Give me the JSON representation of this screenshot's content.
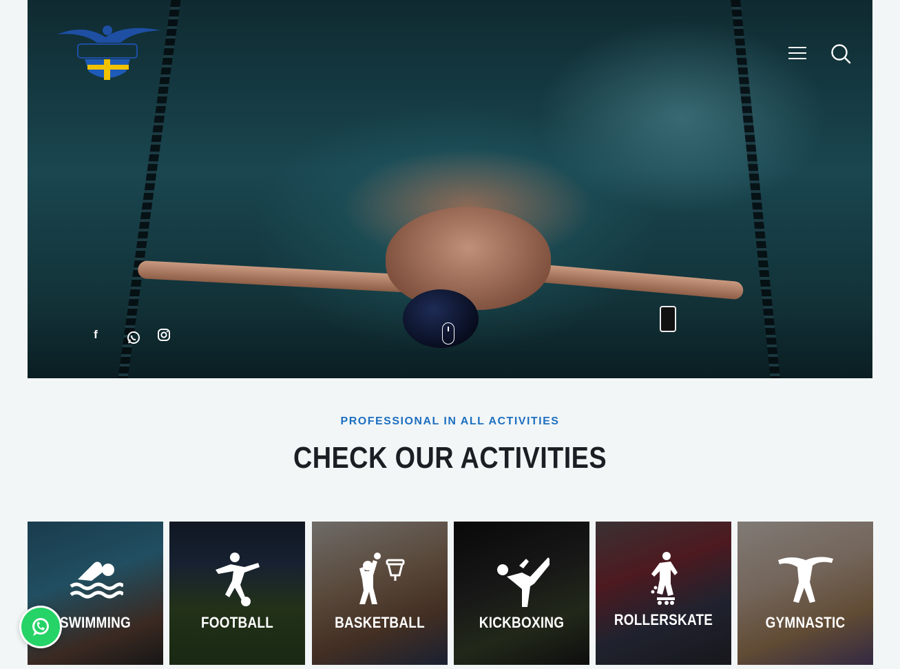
{
  "header": {
    "logo": {
      "alt": "club-logo"
    },
    "menu_icon": "hamburger-menu-icon",
    "search_icon": "search-icon"
  },
  "hero": {
    "social": [
      {
        "name": "facebook",
        "glyph": "f"
      },
      {
        "name": "whatsapp"
      },
      {
        "name": "instagram"
      }
    ],
    "scroll_hint": "mouse-scroll-icon"
  },
  "activities": {
    "eyebrow": "PROFESSIONAL IN ALL ACTIVITIES",
    "heading": "CHECK OUR ACTIVITIES",
    "cards": [
      {
        "label": "SWIMMING",
        "icon": "swimmer-icon"
      },
      {
        "label": "FOOTBALL",
        "icon": "football-player-icon"
      },
      {
        "label": "BASKETBALL",
        "icon": "basketball-player-icon"
      },
      {
        "label": "KICKBOXING",
        "icon": "kickboxer-icon"
      },
      {
        "label": "ROLLERSKATE",
        "icon": "rollerskater-icon"
      },
      {
        "label": "GYMNASTIC",
        "icon": "gymnast-icon"
      }
    ]
  },
  "floating": {
    "whatsapp_icon": "whatsapp-icon"
  },
  "colors": {
    "accent": "#1d6fc0",
    "heading": "#1b1f24",
    "whatsapp": "#25d366",
    "page_bg": "#f2f6f7"
  }
}
